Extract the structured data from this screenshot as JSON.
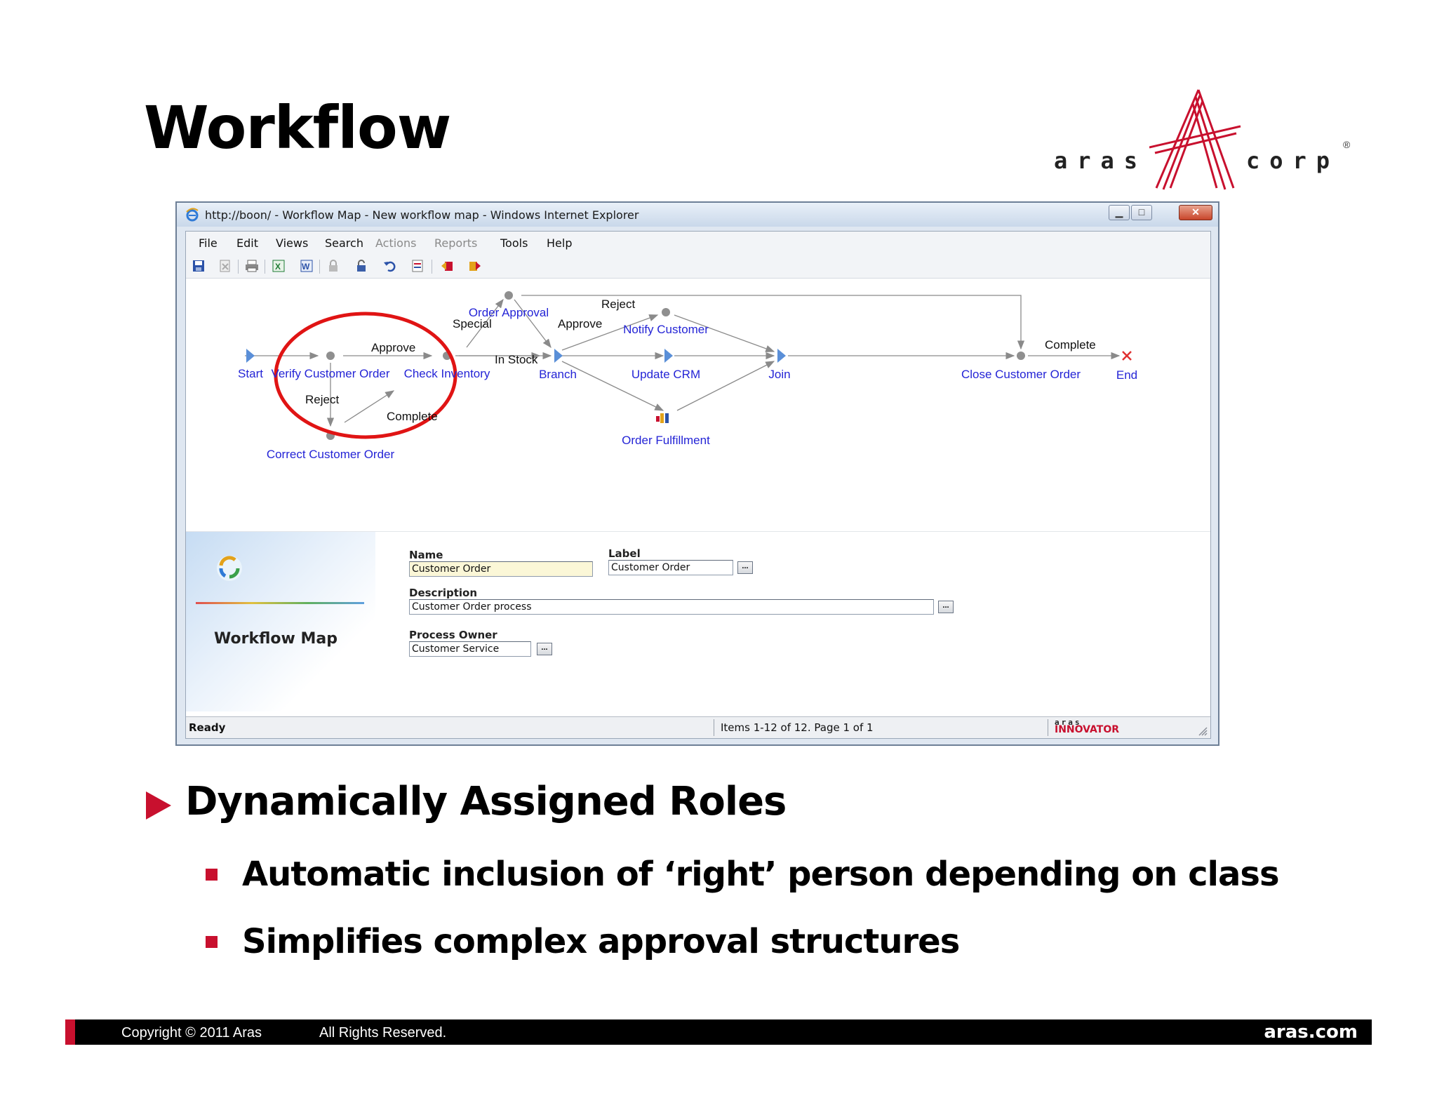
{
  "slide": {
    "title": "Workflow",
    "logo": {
      "left_text": "aras",
      "right_text": "corp",
      "registered": "®"
    }
  },
  "window": {
    "title": "http://boon/ - Workflow Map - New workflow map - Windows Internet Explorer",
    "menu": [
      {
        "label": "File",
        "enabled": true
      },
      {
        "label": "Edit",
        "enabled": true
      },
      {
        "label": "Views",
        "enabled": true
      },
      {
        "label": "Search",
        "enabled": true
      },
      {
        "label": "Actions",
        "enabled": false
      },
      {
        "label": "Reports",
        "enabled": false
      },
      {
        "label": "Tools",
        "enabled": true
      },
      {
        "label": "Help",
        "enabled": true
      }
    ],
    "toolbar_icons": [
      "save-icon",
      "discard-icon",
      "print-icon",
      "excel-icon",
      "word-icon",
      "lock-icon",
      "unlock-icon",
      "undo-icon",
      "export-icon",
      "promote-icon",
      "demote-icon"
    ]
  },
  "workflow": {
    "nodes": {
      "start": "Start",
      "verify": "Verify Customer Order",
      "correct": "Correct Customer Order",
      "check": "Check Inventory",
      "approval": "Order Approval",
      "branch": "Branch",
      "notify": "Notify Customer",
      "crm": "Update CRM",
      "fulfillment": "Order Fulfillment",
      "join": "Join",
      "close": "Close Customer Order",
      "end": "End"
    },
    "paths": {
      "approve1": "Approve",
      "reject1": "Reject",
      "complete1": "Complete",
      "special": "Special",
      "instock": "In Stock",
      "approve2": "Approve",
      "reject2": "Reject",
      "complete2": "Complete"
    }
  },
  "form": {
    "heading": "Workflow Map",
    "name_label": "Name",
    "name_value": "Customer Order",
    "label_label": "Label",
    "label_value": "Customer Order",
    "description_label": "Description",
    "description_value": "Customer Order process",
    "owner_label": "Process Owner",
    "owner_value": "Customer Service",
    "ellipsis": "..."
  },
  "status": {
    "state": "Ready",
    "items": "Items 1-12 of 12. Page 1 of 1",
    "brand_top": "aras",
    "brand_bottom": "INNOVATOR"
  },
  "bullets": {
    "main": "Dynamically Assigned Roles",
    "sub1": "Automatic inclusion of ‘right’ person depending on class",
    "sub2": "Simplifies complex approval structures"
  },
  "footer": {
    "copyright": "Copyright © 2011 Aras",
    "rights": "All Rights Reserved.",
    "site": "aras.com"
  },
  "colors": {
    "accent_red": "#c8102e",
    "node_label": "#2424d6"
  }
}
